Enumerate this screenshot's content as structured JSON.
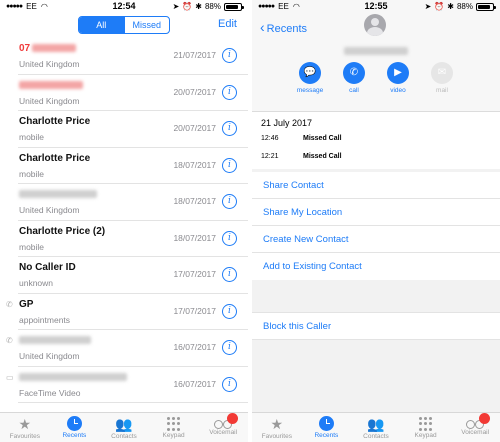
{
  "left": {
    "status": {
      "carrier": "EE",
      "time": "12:54",
      "battery": "88%"
    },
    "segment": {
      "all": "All",
      "missed": "Missed"
    },
    "edit_label": "Edit",
    "calls": [
      {
        "name": "07",
        "name_blurred": true,
        "sub": "United Kingdom",
        "date": "21/07/2017",
        "missed": true
      },
      {
        "name": "",
        "name_blurred": true,
        "sub": "United Kingdom",
        "date": "20/07/2017",
        "missed": true
      },
      {
        "name": "Charlotte Price",
        "sub": "mobile",
        "date": "20/07/2017"
      },
      {
        "name": "Charlotte Price",
        "sub": "mobile",
        "date": "18/07/2017"
      },
      {
        "name": "",
        "name_blurred": true,
        "sub": "United Kingdom",
        "date": "18/07/2017"
      },
      {
        "name": "Charlotte Price (2)",
        "sub": "mobile",
        "date": "18/07/2017"
      },
      {
        "name": "No Caller ID",
        "sub": "unknown",
        "date": "17/07/2017"
      },
      {
        "name": "GP",
        "sub": "appointments",
        "date": "17/07/2017",
        "outgoing": true
      },
      {
        "name": "",
        "name_blurred": true,
        "sub": "United Kingdom",
        "date": "16/07/2017",
        "outgoing": true
      },
      {
        "name": "",
        "name_blurred": true,
        "sub": "FaceTime Video",
        "date": "16/07/2017",
        "video": true
      }
    ]
  },
  "right": {
    "status": {
      "carrier": "EE",
      "time": "12:55",
      "battery": "88%"
    },
    "back_label": "Recents",
    "actions": {
      "message": "message",
      "call": "call",
      "video": "video",
      "mail": "mail"
    },
    "call_date": "21 July 2017",
    "call_log": [
      {
        "time": "12:46",
        "type": "Missed Call"
      },
      {
        "time": "12:21",
        "type": "Missed Call"
      }
    ],
    "options": [
      "Share Contact",
      "Share My Location",
      "Create New Contact",
      "Add to Existing Contact"
    ],
    "block_label": "Block this Caller"
  },
  "tabs": {
    "favourites": "Favourites",
    "recents": "Recents",
    "contacts": "Contacts",
    "keypad": "Keypad",
    "voicemail": "Voicemail"
  },
  "colors": {
    "accent": "#1e7cf7",
    "missed": "#f03b3b",
    "badge": "#f23a35"
  }
}
